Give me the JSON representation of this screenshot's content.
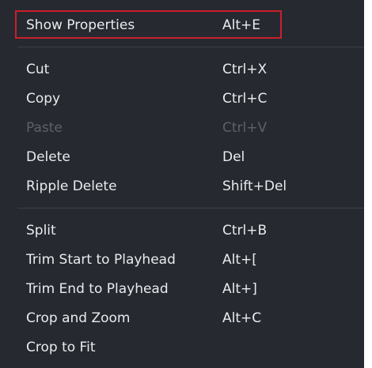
{
  "colors": {
    "menu_background": "#262a30",
    "text": "#e9ebee",
    "disabled_text": "#5c6168",
    "separator": "#3b4047",
    "highlight_border": "#cc1e2c"
  },
  "context_menu": {
    "groups": [
      {
        "items": [
          {
            "label": "Show Properties",
            "shortcut": "Alt+E",
            "highlighted": true
          }
        ]
      },
      {
        "items": [
          {
            "label": "Cut",
            "shortcut": "Ctrl+X"
          },
          {
            "label": "Copy",
            "shortcut": "Ctrl+C"
          },
          {
            "label": "Paste",
            "shortcut": "Ctrl+V",
            "disabled": true
          },
          {
            "label": "Delete",
            "shortcut": "Del"
          },
          {
            "label": "Ripple Delete",
            "shortcut": "Shift+Del"
          }
        ]
      },
      {
        "items": [
          {
            "label": "Split",
            "shortcut": "Ctrl+B"
          },
          {
            "label": "Trim Start to Playhead",
            "shortcut": "Alt+["
          },
          {
            "label": "Trim End to Playhead",
            "shortcut": "Alt+]"
          },
          {
            "label": "Crop and Zoom",
            "shortcut": "Alt+C"
          },
          {
            "label": "Crop to Fit",
            "shortcut": ""
          }
        ]
      }
    ]
  }
}
